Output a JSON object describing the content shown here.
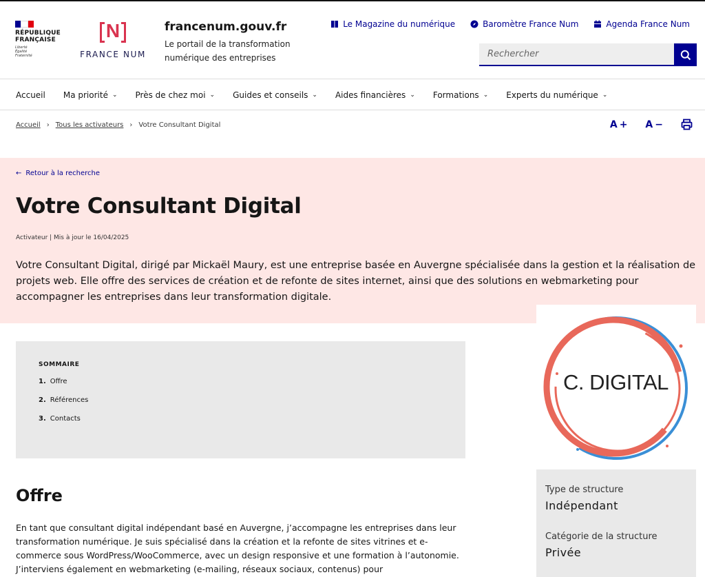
{
  "header": {
    "gov_title_line1": "RÉPUBLIQUE",
    "gov_title_line2": "FRANÇAISE",
    "gov_motto_1": "Liberté",
    "gov_motto_2": "Égalité",
    "gov_motto_3": "Fraternité",
    "brand_letter": "N",
    "brand_name": "FRANCE NUM",
    "site_name": "francenum.gouv.fr",
    "site_tagline": "Le portail de la transformation numérique des entreprises",
    "quick_links": [
      {
        "label": "Le Magazine du numérique",
        "icon": "book-icon"
      },
      {
        "label": "Baromètre France Num",
        "icon": "compass-icon"
      },
      {
        "label": "Agenda France Num",
        "icon": "calendar-icon"
      }
    ],
    "search_placeholder": "Rechercher"
  },
  "nav": {
    "items": [
      {
        "label": "Accueil",
        "has_dropdown": false
      },
      {
        "label": "Ma priorité",
        "has_dropdown": true
      },
      {
        "label": "Près de chez moi",
        "has_dropdown": true
      },
      {
        "label": "Guides et conseils",
        "has_dropdown": true
      },
      {
        "label": "Aides financières",
        "has_dropdown": true
      },
      {
        "label": "Formations",
        "has_dropdown": true
      },
      {
        "label": "Experts du numérique",
        "has_dropdown": true
      }
    ]
  },
  "breadcrumb": {
    "items": [
      "Accueil",
      "Tous les activateurs",
      "Votre Consultant Digital"
    ]
  },
  "tools": {
    "increase": "A",
    "decrease": "A"
  },
  "hero": {
    "back_label": "Retour à la recherche",
    "title": "Votre Consultant Digital",
    "meta": "Activateur | Mis à jour le 16/04/2025",
    "lead": "Votre Consultant Digital, dirigé par Mickaël Maury, est une entreprise basée en Auvergne spécialisée dans la gestion et la réalisation de projets web. Elle offre des services de création et de refonte de sites internet, ainsi que des solutions en webmarketing pour accompagner les entreprises dans leur transformation digitale."
  },
  "logo": {
    "text": "C. DIGITAL",
    "colors": {
      "ring_outer": "#3a8fd6",
      "ring_inner": "#e8685a"
    }
  },
  "summary": {
    "title": "SOMMAIRE",
    "items": [
      {
        "num": "1.",
        "label": "Offre"
      },
      {
        "num": "2.",
        "label": "Références"
      },
      {
        "num": "3.",
        "label": "Contacts"
      }
    ]
  },
  "info": {
    "type_label": "Type de structure",
    "type_value": "Indépendant",
    "category_label": "Catégorie de la structure",
    "category_value": "Privée"
  },
  "content": {
    "offre_title": "Offre",
    "offre_text": "En tant que consultant digital indépendant basé en Auvergne, j’accompagne les entreprises dans leur transformation numérique. Je suis spécialisé dans la création et la refonte de sites vitrines et e-commerce sous WordPress/WooCommerce, avec un design responsive et une formation à l’autonomie. J’interviens également en webmarketing (e-mailing, réseaux sociaux, contenus) pour"
  },
  "colors": {
    "primary": "#000091",
    "hero_bg": "#fee7e5",
    "brand_red": "#d9334f",
    "panel_bg": "#e9e9e9"
  }
}
